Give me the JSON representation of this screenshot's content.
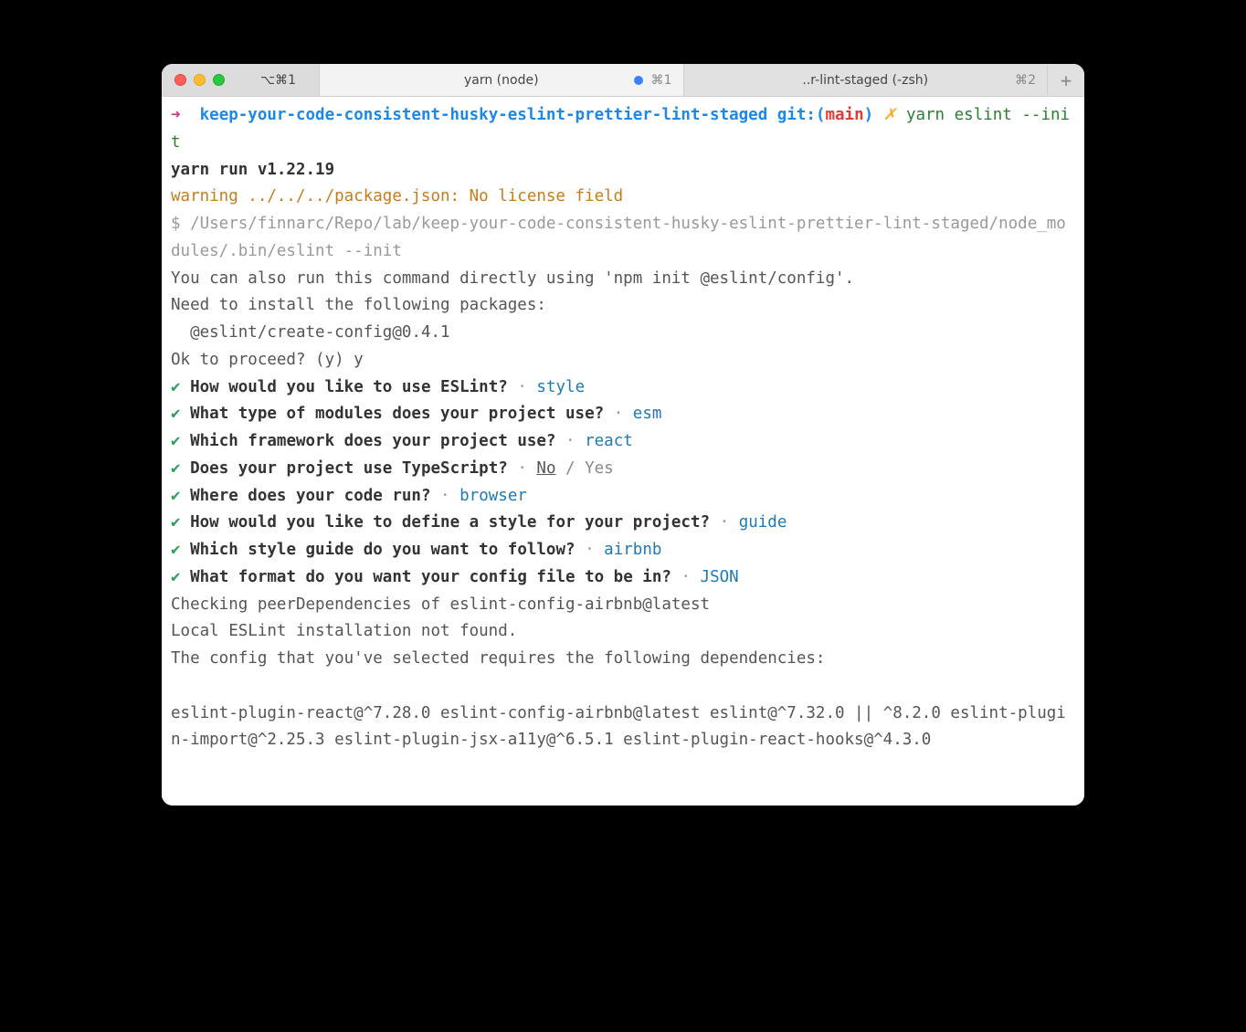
{
  "tabs": {
    "first_shortcut": "⌥⌘1",
    "active_label": "yarn (node)",
    "active_shortcut": "⌘1",
    "inactive_label": "..r-lint-staged (-zsh)",
    "inactive_shortcut": "⌘2",
    "newtab_glyph": "+"
  },
  "prompt": {
    "arrow": "➜",
    "cwd": "keep-your-code-consistent-husky-eslint-prettier-lint-staged",
    "git_label": "git:(",
    "git_branch": "main",
    "git_paren_close": ")",
    "git_dirty": "✗",
    "command": "yarn eslint --init"
  },
  "run_line": "yarn run v1.22.19",
  "warn_line": "warning ../../../package.json: No license field",
  "bin_line": "$ /Users/finnarc/Repo/lab/keep-your-code-consistent-husky-eslint-prettier-lint-staged/node_modules/.bin/eslint --init",
  "npm_info": "You can also run this command directly using 'npm init @eslint/config'.",
  "install_msg": "Need to install the following packages:",
  "install_pkg": "  @eslint/create-config@0.4.1",
  "proceed": "Ok to proceed? (y) y",
  "check_glyph": "✔",
  "separator": "·",
  "questions": [
    {
      "q": "How would you like to use ESLint?",
      "a": "style",
      "type": "ans"
    },
    {
      "q": "What type of modules does your project use?",
      "a": "esm",
      "type": "ans"
    },
    {
      "q": "Which framework does your project use?",
      "a": "react",
      "type": "ans"
    },
    {
      "q": "Does your project use TypeScript?",
      "a_no": "No",
      "a_rest": " / Yes",
      "type": "noyes"
    },
    {
      "q": "Where does your code run?",
      "a": "browser",
      "type": "ans"
    },
    {
      "q": "How would you like to define a style for your project?",
      "a": "guide",
      "type": "ans"
    },
    {
      "q": "Which style guide do you want to follow?",
      "a": "airbnb",
      "type": "ans"
    },
    {
      "q": "What format do you want your config file to be in?",
      "a": "JSON",
      "type": "ans"
    }
  ],
  "tail": [
    "Checking peerDependencies of eslint-config-airbnb@latest",
    "Local ESLint installation not found.",
    "The config that you've selected requires the following dependencies:",
    "",
    "eslint-plugin-react@^7.28.0 eslint-config-airbnb@latest eslint@^7.32.0 || ^8.2.0 eslint-plugin-import@^2.25.3 eslint-plugin-jsx-a11y@^6.5.1 eslint-plugin-react-hooks@^4.3.0"
  ]
}
